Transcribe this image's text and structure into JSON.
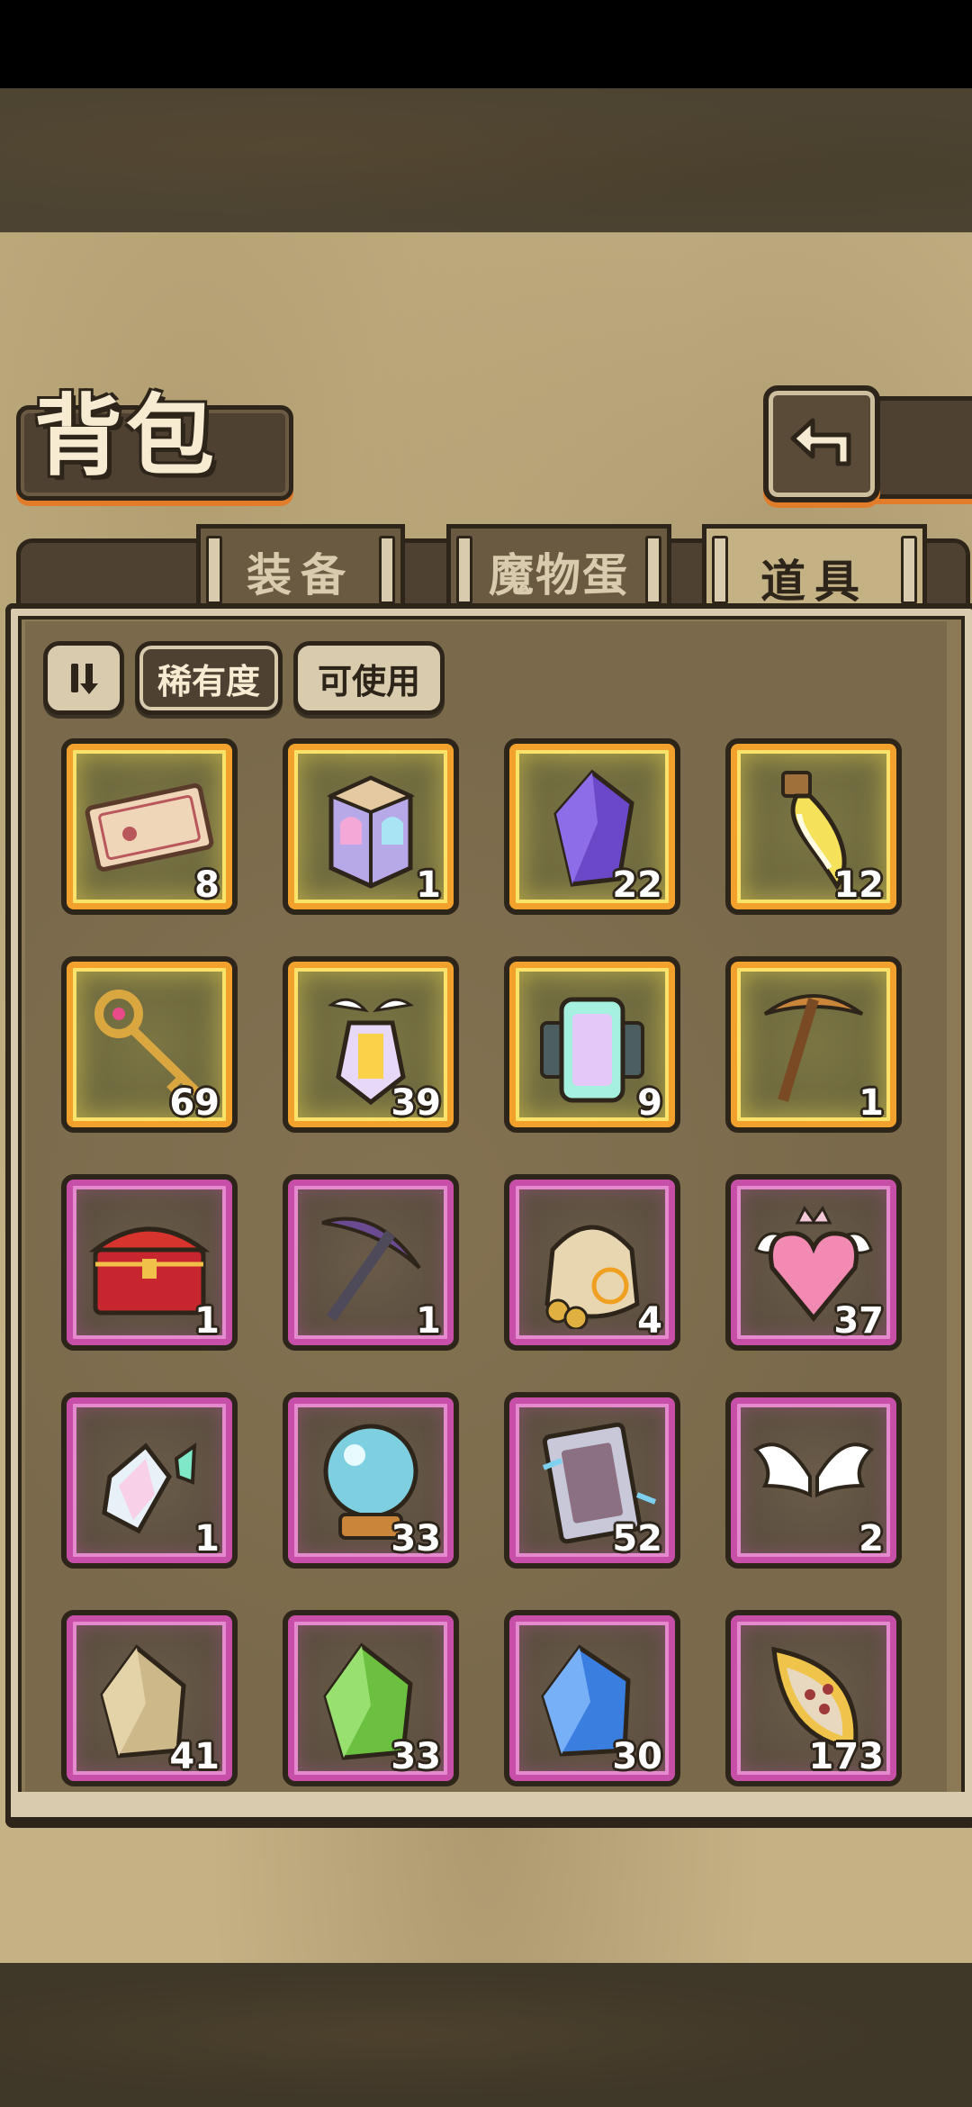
{
  "header": {
    "title": "背包"
  },
  "tabs": [
    {
      "label": "装备",
      "active": false
    },
    {
      "label": "魔物蛋",
      "active": false
    },
    {
      "label": "道具",
      "active": true
    }
  ],
  "filters": {
    "rarity_label": "稀有度",
    "usable_label": "可使用"
  },
  "colors": {
    "gold_rarity": "#f2a12c",
    "purple_rarity": "#c74fa7",
    "panel": "#7a6a4b",
    "outline": "#2d241a"
  },
  "items": [
    {
      "icon": "ticket-icon",
      "count": "8",
      "rarity": "gold"
    },
    {
      "icon": "rainbow-cube-icon",
      "count": "1",
      "rarity": "gold"
    },
    {
      "icon": "purple-crystal-icon",
      "count": "22",
      "rarity": "gold"
    },
    {
      "icon": "yellow-potion-icon",
      "count": "12",
      "rarity": "gold"
    },
    {
      "icon": "golden-key-icon",
      "count": "69",
      "rarity": "gold"
    },
    {
      "icon": "winged-lantern-icon",
      "count": "39",
      "rarity": "gold"
    },
    {
      "icon": "crystal-machine-icon",
      "count": "9",
      "rarity": "gold"
    },
    {
      "icon": "pickaxe-icon",
      "count": "1",
      "rarity": "gold"
    },
    {
      "icon": "treasure-chest-icon",
      "count": "1",
      "rarity": "purple"
    },
    {
      "icon": "purple-pickaxe-icon",
      "count": "1",
      "rarity": "purple"
    },
    {
      "icon": "coin-bag-icon",
      "count": "4",
      "rarity": "purple"
    },
    {
      "icon": "winged-heart-icon",
      "count": "37",
      "rarity": "purple"
    },
    {
      "icon": "rainbow-shard-icon",
      "count": "1",
      "rarity": "purple"
    },
    {
      "icon": "crystal-ball-icon",
      "count": "33",
      "rarity": "purple"
    },
    {
      "icon": "magic-card-icon",
      "count": "52",
      "rarity": "purple"
    },
    {
      "icon": "white-wings-icon",
      "count": "2",
      "rarity": "purple"
    },
    {
      "icon": "brown-gem-icon",
      "count": "41",
      "rarity": "purple"
    },
    {
      "icon": "green-gem-icon",
      "count": "33",
      "rarity": "purple"
    },
    {
      "icon": "blue-gem-icon",
      "count": "30",
      "rarity": "purple"
    },
    {
      "icon": "seed-pod-icon",
      "count": "173",
      "rarity": "purple"
    }
  ]
}
